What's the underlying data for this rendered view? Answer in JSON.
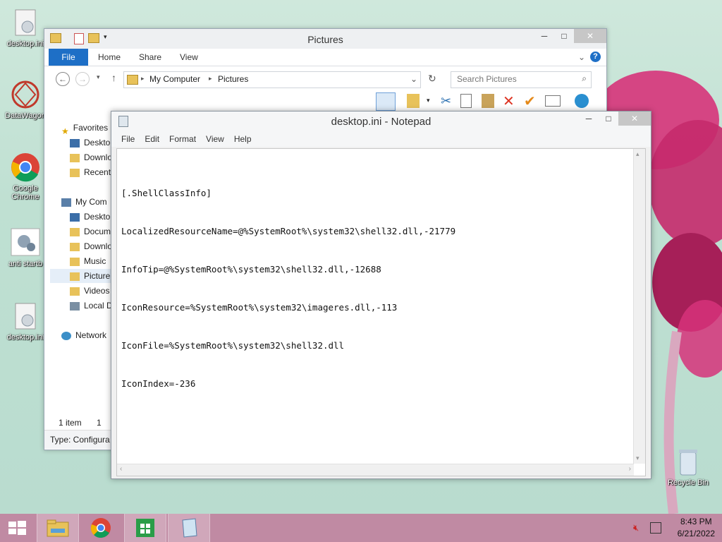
{
  "desktop": {
    "icons": [
      {
        "label": "desktop.ini"
      },
      {
        "label": "DataWagon"
      },
      {
        "label": "Google Chrome"
      },
      {
        "label": "anti startb"
      },
      {
        "label": "desktop.ini"
      },
      {
        "label": "Recycle Bin"
      }
    ]
  },
  "explorer": {
    "title": "Pictures",
    "tabs": [
      {
        "label": "File"
      },
      {
        "label": "Home"
      },
      {
        "label": "Share"
      },
      {
        "label": "View"
      }
    ],
    "breadcrumb": [
      "My Computer",
      "Pictures"
    ],
    "search_placeholder": "Search Pictures",
    "nav": {
      "favorites": "Favorites",
      "favorites_items": [
        "Deskto",
        "Downlo",
        "Recent"
      ],
      "computer": "My Com",
      "computer_items": [
        "Deskto",
        "Docum",
        "Downlo",
        "Music",
        "Picture",
        "Videos",
        "Local D"
      ],
      "network": "Network"
    },
    "status_left": "1 item",
    "status_right": "1 ite",
    "type_bar": "Type: Configura"
  },
  "notepad": {
    "title": "desktop.ini - Notepad",
    "menu": [
      "File",
      "Edit",
      "Format",
      "View",
      "Help"
    ],
    "lines": [
      "[.ShellClassInfo]",
      "LocalizedResourceName=@%SystemRoot%\\system32\\shell32.dll,-21779",
      "InfoTip=@%SystemRoot%\\system32\\shell32.dll,-12688",
      "IconResource=%SystemRoot%\\system32\\imageres.dll,-113",
      "IconFile=%SystemRoot%\\system32\\shell32.dll",
      "IconIndex=-236"
    ]
  },
  "taskbar": {
    "time": "8:43 PM",
    "date": "6/21/2022",
    "apps": [
      "file-explorer",
      "google-chrome",
      "store",
      "notepad"
    ]
  },
  "colors": {
    "accent": "#1e6fc6",
    "taskbar": "#c08aa3",
    "flower": "#d6337a"
  }
}
